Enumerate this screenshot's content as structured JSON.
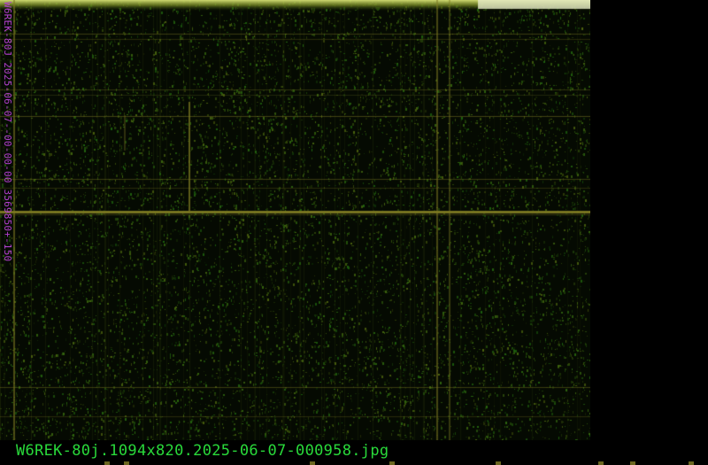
{
  "side_label": "W6REK-80J 2025-06-07--00-00-00 3569850+-150",
  "filename": "W6REK-80j.1094x820.2025-06-07-000958.jpg",
  "colors": {
    "background": "#000000",
    "noise": "#3a5a10",
    "line": "#7d7a22",
    "side_label": "#b43fd0",
    "filename": "#29d93a"
  }
}
